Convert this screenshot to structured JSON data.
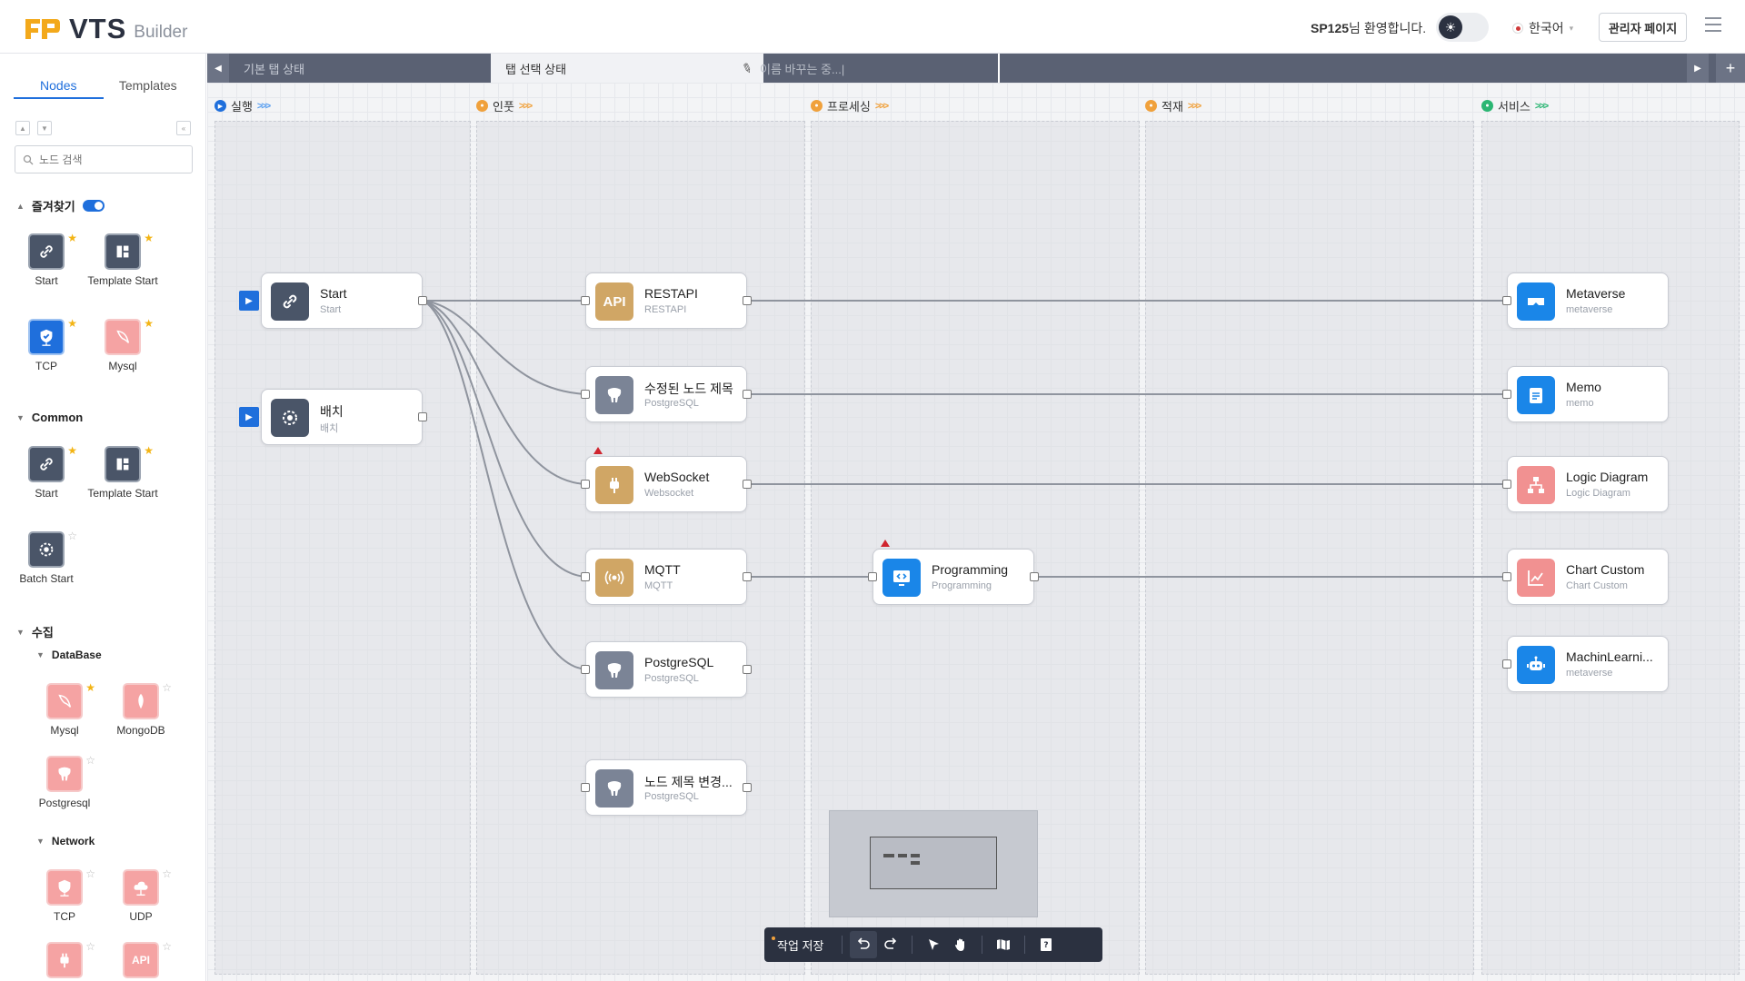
{
  "header": {
    "logo_text": "VTS",
    "logo_sub": "Builder",
    "welcome_user": "SP125",
    "welcome_suffix": "님 환영합니다.",
    "language": "한국어",
    "admin_button": "관리자 페이지"
  },
  "sidebar": {
    "tabs": [
      "Nodes",
      "Templates"
    ],
    "search_placeholder": "노드 검색",
    "sections": {
      "favorites": "즐겨찾기",
      "common": "Common",
      "collect": "수집",
      "database": "DataBase",
      "network": "Network"
    },
    "tiles": {
      "fav_start": "Start",
      "fav_template_start": "Template Start",
      "fav_tcp": "TCP",
      "fav_mysql": "Mysql",
      "common_start": "Start",
      "common_template_start": "Template Start",
      "common_batch_start": "Batch Start",
      "db_mysql": "Mysql",
      "db_mongodb": "MongoDB",
      "db_postgresql": "Postgresql",
      "net_tcp": "TCP",
      "net_udp": "UDP",
      "net_api_badge": "API"
    }
  },
  "canvas_tabs": {
    "tab1": "기본 탭 상태",
    "tab2": "탭 선택 상태",
    "tab3": "이름 바꾸는 중...|"
  },
  "lanes": {
    "run": "실행",
    "input": "인풋",
    "process": "프로세싱",
    "load": "적재",
    "service": "서비스"
  },
  "colors": {
    "accent": "#1f6fdc",
    "lane_orange": "#f0a13c",
    "lane_green": "#2bb673",
    "star": "#f3b414"
  },
  "nodes": {
    "start": {
      "title": "Start",
      "sub": "Start"
    },
    "batch": {
      "title": "배치",
      "sub": "배치"
    },
    "restapi": {
      "title": "RESTAPI",
      "sub": "RESTAPI",
      "badge": "API"
    },
    "pg_edited": {
      "title": "수정된 노드 제목",
      "sub": "PostgreSQL"
    },
    "websocket": {
      "title": "WebSocket",
      "sub": "Websocket"
    },
    "mqtt": {
      "title": "MQTT",
      "sub": "MQTT"
    },
    "postgresql": {
      "title": "PostgreSQL",
      "sub": "PostgreSQL"
    },
    "pg_renamed": {
      "title": "노드 제목 변경...",
      "sub": "PostgreSQL"
    },
    "programming": {
      "title": "Programming",
      "sub": "Programming"
    },
    "metaverse": {
      "title": "Metaverse",
      "sub": "metaverse"
    },
    "memo": {
      "title": "Memo",
      "sub": "memo"
    },
    "logic": {
      "title": "Logic Diagram",
      "sub": "Logic Diagram"
    },
    "chart": {
      "title": "Chart Custom",
      "sub": "Chart Custom"
    },
    "ml": {
      "title": "MachinLearni...",
      "sub": "metaverse"
    }
  },
  "toolbar": {
    "save_label": "작업 저장"
  }
}
